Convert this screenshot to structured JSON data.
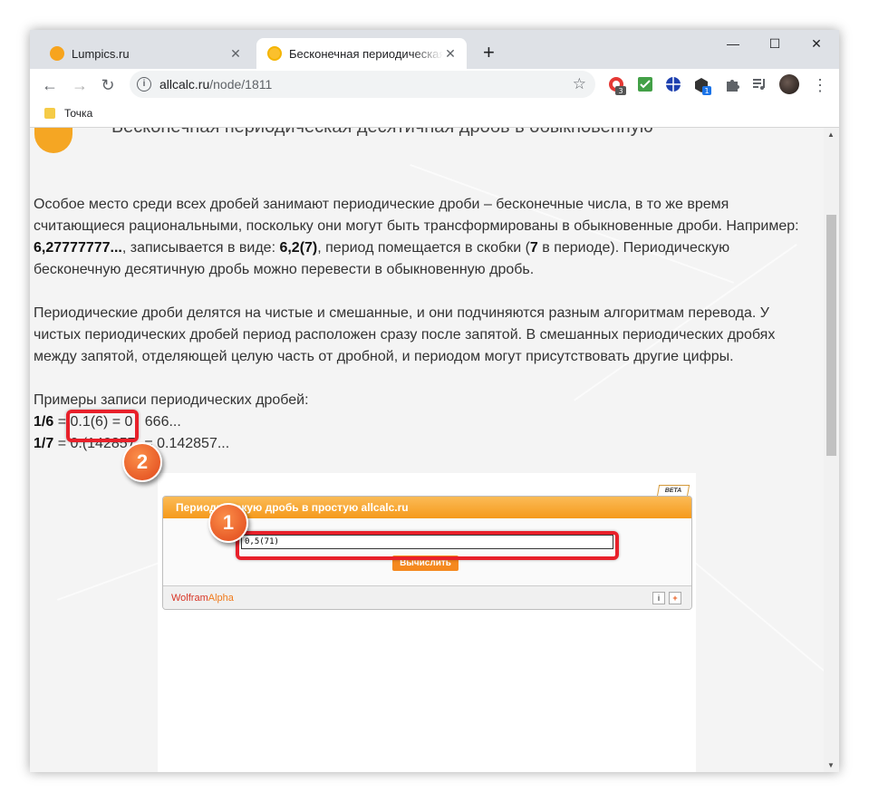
{
  "browser": {
    "tabs": [
      {
        "title": "Lumpics.ru",
        "active": false
      },
      {
        "title": "Бесконечная периодическая де",
        "active": true
      }
    ],
    "url_domain": "allcalc.ru",
    "url_path": "/node/1811",
    "bookmark": "Точка",
    "extension_badges": [
      "3",
      "1"
    ]
  },
  "page": {
    "heading": "Бесконечная периодическая десятичная дробь в обыкновенную",
    "p1": {
      "t1": "Особое место среди всех дробей занимают периодические дроби – бесконечные числа, в то же время считающиеся рациональными, поскольку они могут быть трансформированы в обыкновенные дроби. Например: ",
      "b1": "6,27777777...",
      "t2": ", записывается в виде: ",
      "b2": "6,2(7)",
      "t3": ", период помещается в скобки (",
      "b3": "7",
      "t4": " в периоде). Периодическую бесконечную десятичную дробь можно перевести в обыкновенную дробь."
    },
    "p2": "Периодические дроби делятся на чистые и смешанные, и они подчиняются разным алгоритмам перевода. У чистых периодических дробей период расположен сразу после запятой. В смешанных периодических дробях между запятой, отделяющей целую часть от дробной, и периодом могут присутствовать другие цифры.",
    "examples_title": "Примеры записи периодических дробей:",
    "ex1": {
      "b": "1/6",
      "t1": " = ",
      "m1": "0.1(6)",
      "t2": " = 0",
      "m2": ".1",
      "t3": "666..."
    },
    "ex2": {
      "b": "1/7",
      "t1": " = ",
      "m1": "0.(142857",
      "m2": ")",
      "t2": " = 0.142857..."
    }
  },
  "widget": {
    "beta": "BETA",
    "title": "Периодическую дробь в простую allcalc.ru",
    "input_value": "0,5(71)",
    "button": "Вычислить",
    "brand_wolfram": "Wolfram",
    "brand_alpha": "Alpha",
    "info_icon": "i",
    "add_icon": "+"
  },
  "annotations": {
    "badge1": "1",
    "badge2": "2"
  },
  "colors": {
    "accent": "#f5891f",
    "callout": "#e8202a"
  }
}
